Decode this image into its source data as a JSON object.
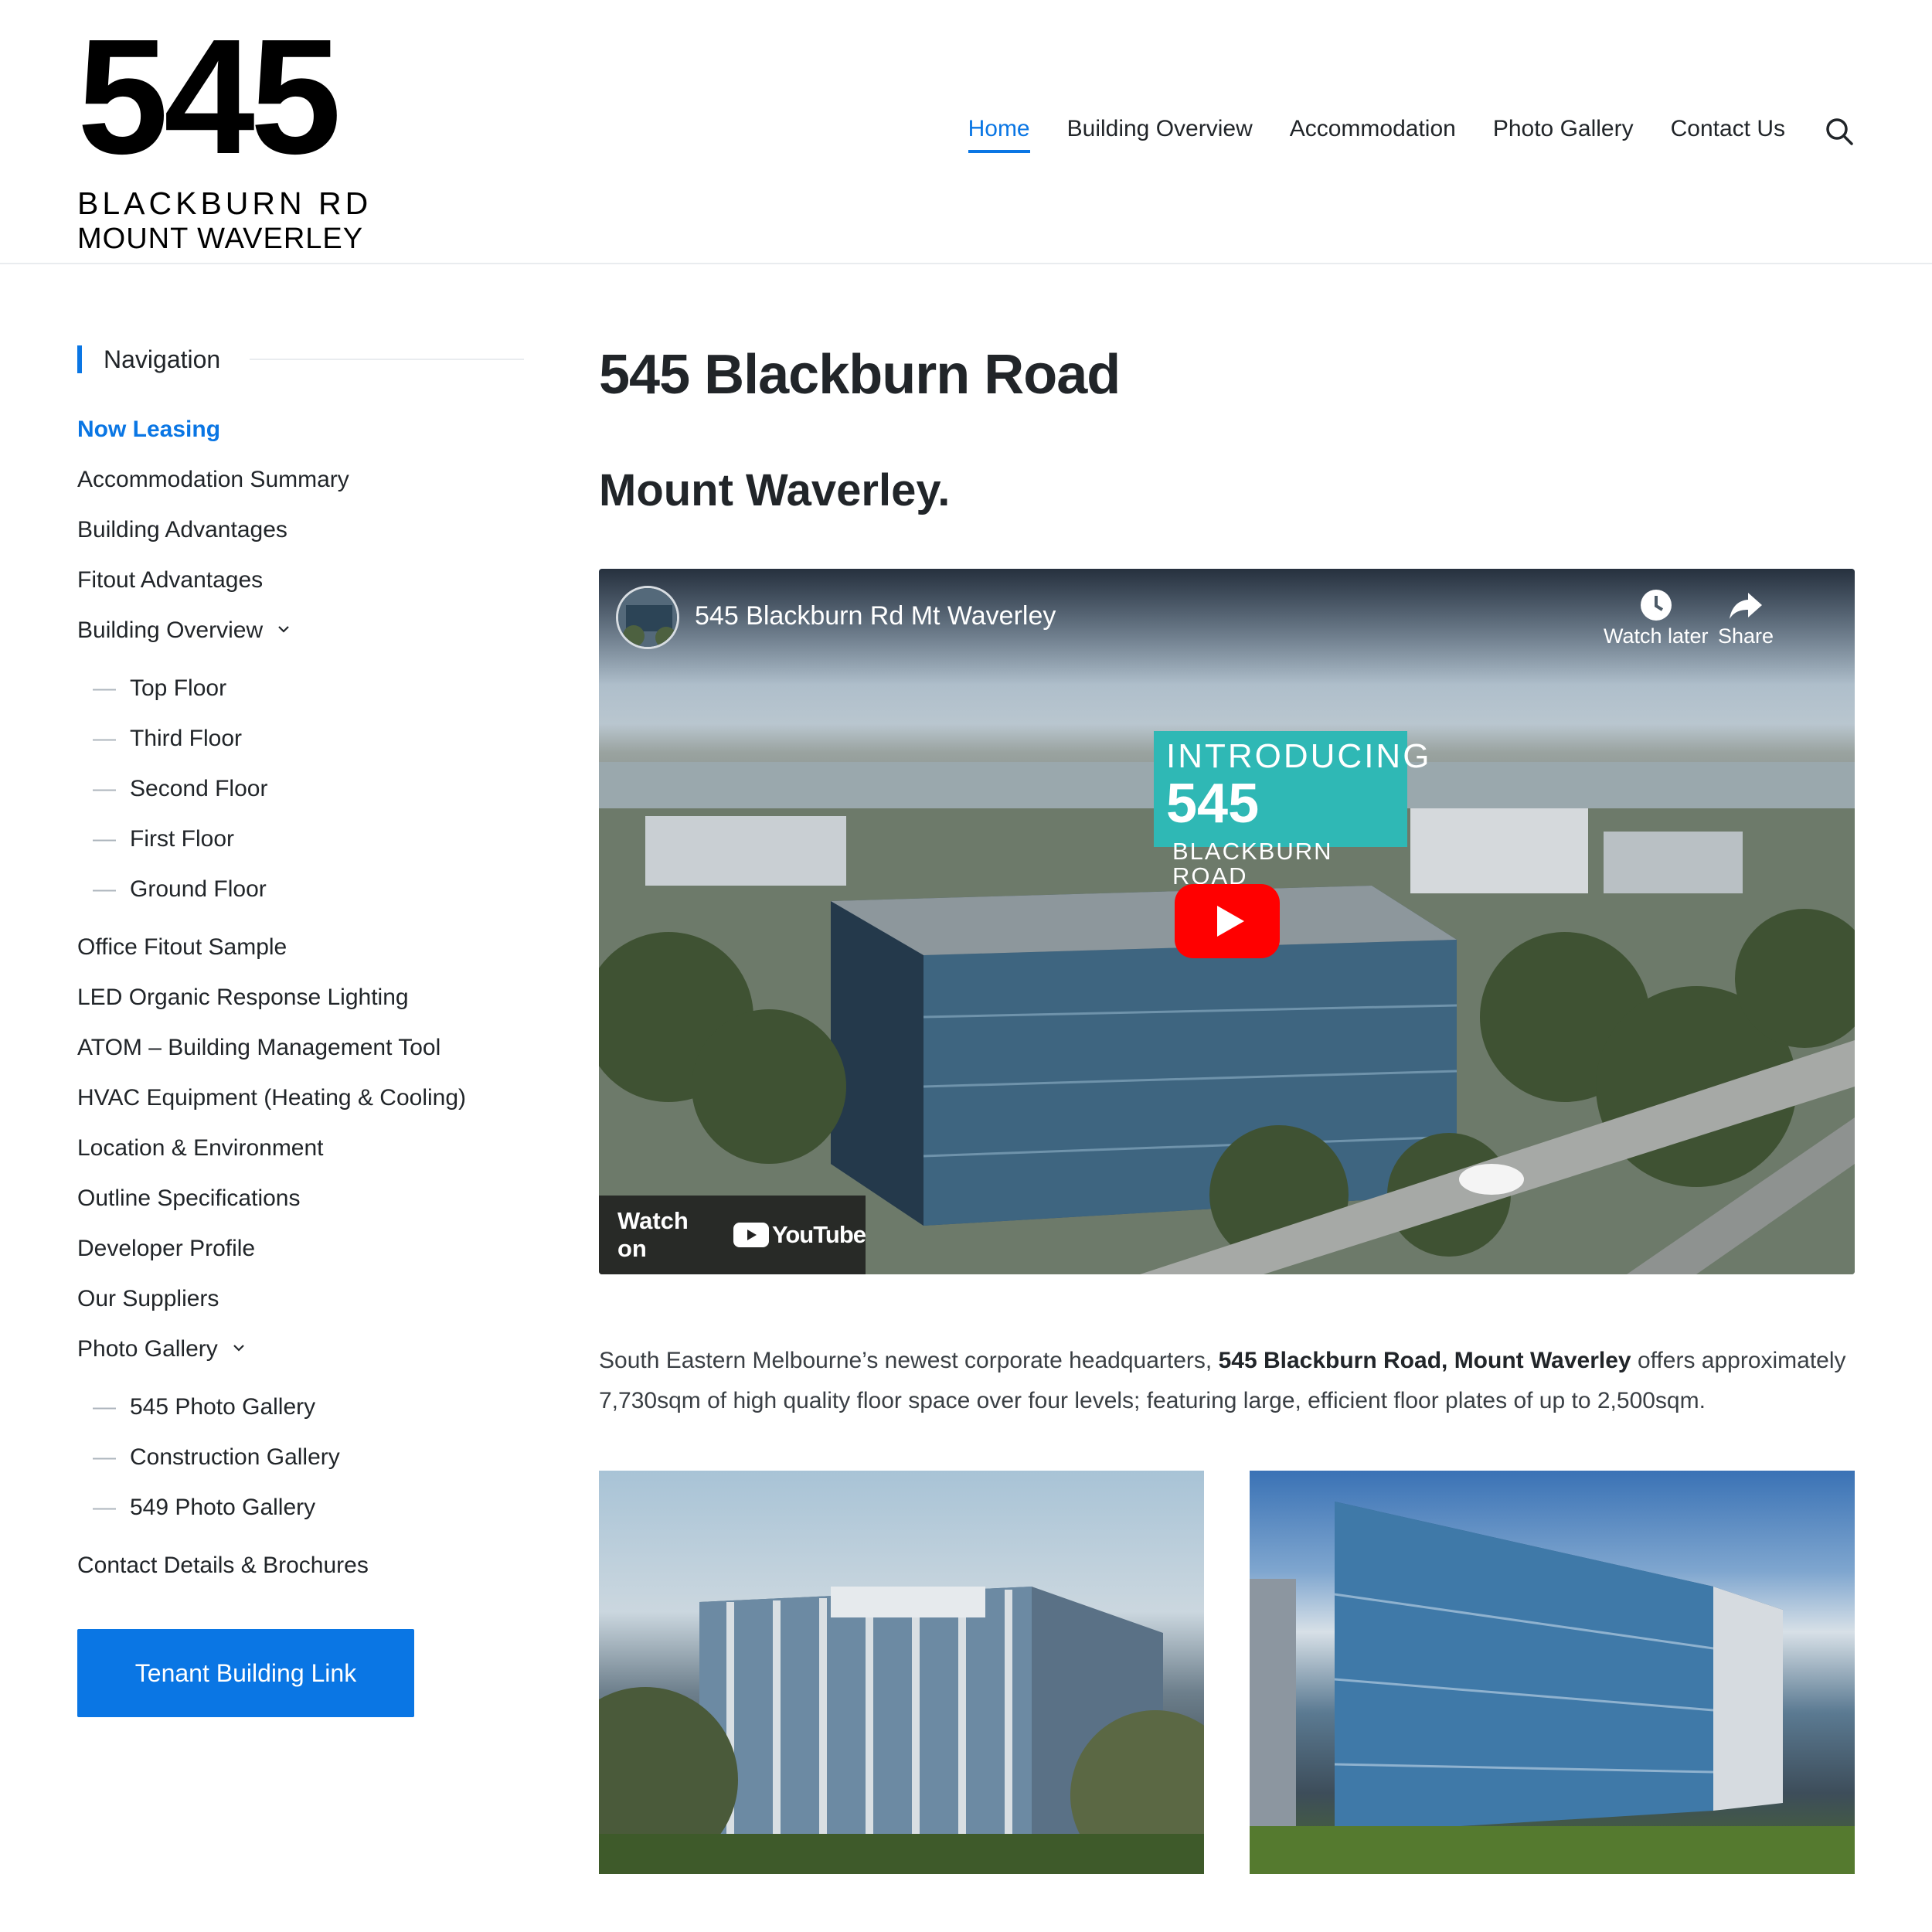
{
  "logo": {
    "number": "545",
    "line1": "BLACKBURN RD",
    "line2": "MOUNT WAVERLEY"
  },
  "nav": {
    "items": [
      {
        "label": "Home",
        "active": true
      },
      {
        "label": "Building Overview"
      },
      {
        "label": "Accommodation"
      },
      {
        "label": "Photo Gallery"
      },
      {
        "label": "Contact Us"
      }
    ],
    "search_icon": "search-icon"
  },
  "sidebar": {
    "heading": "Navigation",
    "items": [
      {
        "label": "Now Leasing",
        "active": true
      },
      {
        "label": "Accommodation Summary"
      },
      {
        "label": "Building Advantages"
      },
      {
        "label": "Fitout Advantages"
      },
      {
        "label": "Building Overview",
        "has_children": true
      },
      {
        "label": "Office Fitout Sample"
      },
      {
        "label": "LED Organic Response Lighting"
      },
      {
        "label": "ATOM – Building Management Tool"
      },
      {
        "label": "HVAC Equipment (Heating & Cooling)"
      },
      {
        "label": "Location & Environment"
      },
      {
        "label": "Outline Specifications"
      },
      {
        "label": "Developer Profile"
      },
      {
        "label": "Our Suppliers"
      },
      {
        "label": "Photo Gallery",
        "has_children": true
      },
      {
        "label": "Contact Details & Brochures"
      }
    ],
    "building_overview_children": [
      "Top Floor",
      "Third Floor",
      "Second Floor",
      "First Floor",
      "Ground Floor"
    ],
    "photo_gallery_children": [
      "545 Photo Gallery",
      "Construction Gallery",
      "549 Photo Gallery"
    ],
    "sub_dash": "—",
    "tenant_button": "Tenant Building Link"
  },
  "main": {
    "title": "545 Blackburn Road",
    "subtitle": "Mount Waverley.",
    "video": {
      "title": "545 Blackburn Rd Mt Waverley",
      "watch_later": "Watch later",
      "share": "Share",
      "overlay_line1": "INTRODUCING",
      "overlay_number": "545",
      "overlay_line2": "BLACKBURN",
      "overlay_line3": "ROAD",
      "watch_on": "Watch on",
      "youtube": "YouTube"
    },
    "body": {
      "part1": "South Eastern Melbourne’s newest corporate headquarters, ",
      "bold": "545 Blackburn Road, Mount Waverley",
      "part2": " offers approximately 7,730sqm of high quality floor space over four levels; featuring large, efficient floor plates of up to 2,500sqm."
    }
  },
  "colors": {
    "accent": "#0a76e4",
    "text": "#212529",
    "youtube_red": "#ff0000",
    "sign_teal": "#2fb8b5"
  }
}
